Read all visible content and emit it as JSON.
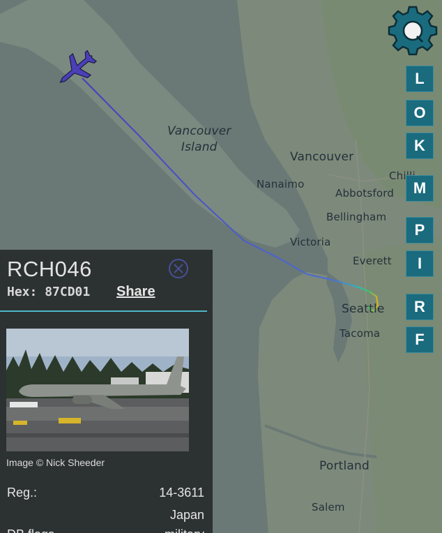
{
  "map": {
    "labels": {
      "vancouver_island": "Vancouver\nIsland",
      "vancouver": "Vancouver",
      "nanaimo": "Nanaimo",
      "abbotsford": "Abbotsford",
      "bellingham": "Bellingham",
      "victoria": "Victoria",
      "everett": "Everett",
      "seattle": "Seattle",
      "tacoma": "Tacoma",
      "portland": "Portland",
      "salem": "Salem",
      "chilliwack": "Chilli"
    }
  },
  "toolbar": {
    "buttons": [
      "L",
      "O",
      "K",
      "M",
      "P",
      "I",
      "R",
      "F"
    ]
  },
  "aircraft": {
    "callsign": "RCH046",
    "hex_label": "Hex:",
    "hex": "87CD01",
    "share_label": "Share",
    "photo_credit": "Image © Nick Sheeder",
    "reg_label": "Reg.:",
    "reg": "14-3611",
    "country": "Japan",
    "cut_label": "DB flags",
    "cut_value": "military"
  },
  "colors": {
    "button_bg": "#1a6b7d",
    "accent": "#4db6c8",
    "track": "#5a50c8"
  }
}
